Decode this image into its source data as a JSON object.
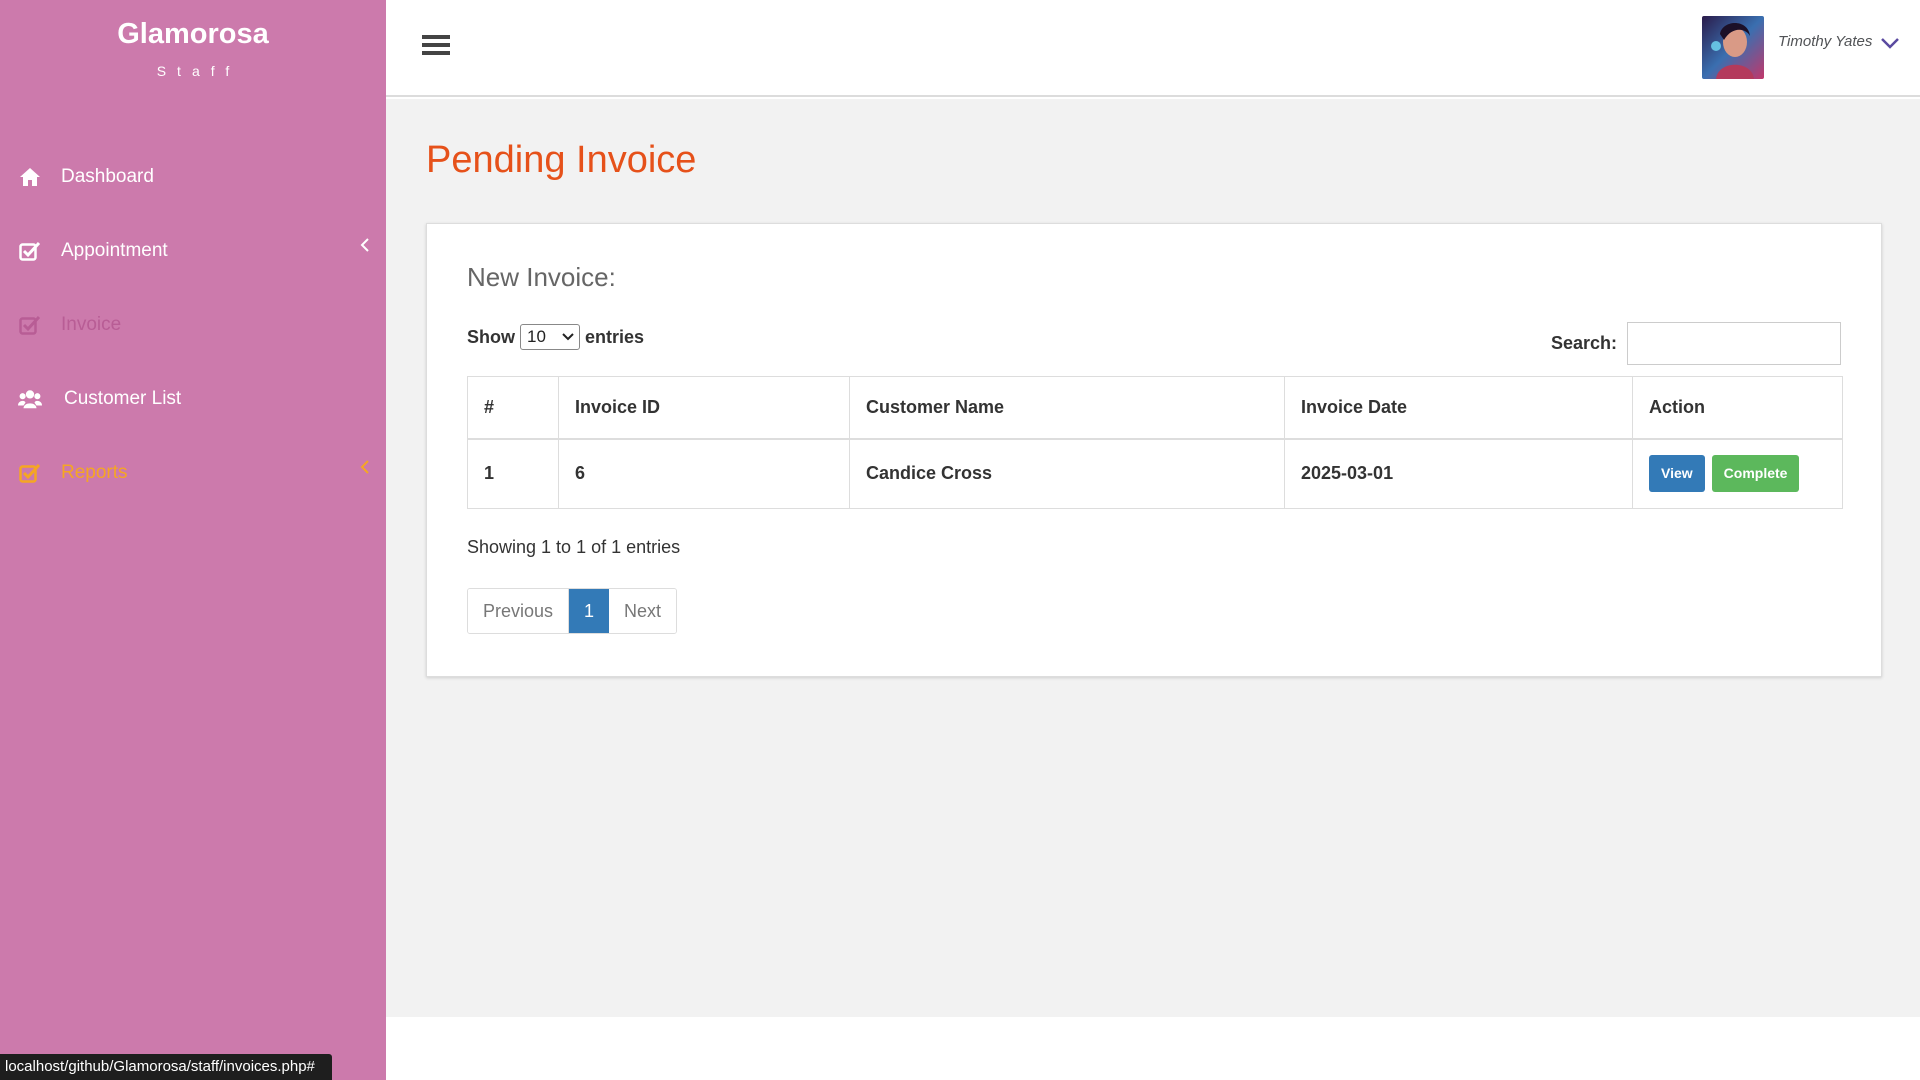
{
  "brand": {
    "title": "Glamorosa",
    "subtitle": "Staff"
  },
  "sidebar": {
    "items": [
      {
        "label": "Dashboard",
        "icon": "home-icon"
      },
      {
        "label": "Appointment",
        "icon": "check-square-icon",
        "has_caret": true
      },
      {
        "label": "Invoice",
        "icon": "check-square-icon",
        "state": "muted"
      },
      {
        "label": "Customer List",
        "icon": "users-icon"
      },
      {
        "label": "Reports",
        "icon": "check-square-icon",
        "has_caret": true,
        "state": "highlight"
      }
    ]
  },
  "header": {
    "user_name": "Timothy Yates"
  },
  "page": {
    "title": "Pending Invoice"
  },
  "panel": {
    "title": "New Invoice:",
    "length": {
      "prefix": "Show",
      "value": "10",
      "suffix": "entries"
    },
    "search": {
      "label": "Search:",
      "value": ""
    },
    "table": {
      "headers": [
        "#",
        "Invoice ID",
        "Customer Name",
        "Invoice Date",
        "Action"
      ],
      "rows": [
        {
          "num": "1",
          "invoice_id": "6",
          "customer": "Candice Cross",
          "date": "2025-03-01"
        }
      ],
      "actions": {
        "view": "View",
        "complete": "Complete"
      }
    },
    "info": "Showing 1 to 1 of 1 entries",
    "pagination": {
      "previous": "Previous",
      "current": "1",
      "next": "Next"
    }
  },
  "status_bar": {
    "url": "localhost/github/Glamorosa/staff/invoices.php#"
  },
  "colors": {
    "sidebar": "#cc7aac",
    "title": "#e6511a",
    "primary": "#337ab7",
    "success": "#5cb85c",
    "highlight": "#f5a623"
  }
}
